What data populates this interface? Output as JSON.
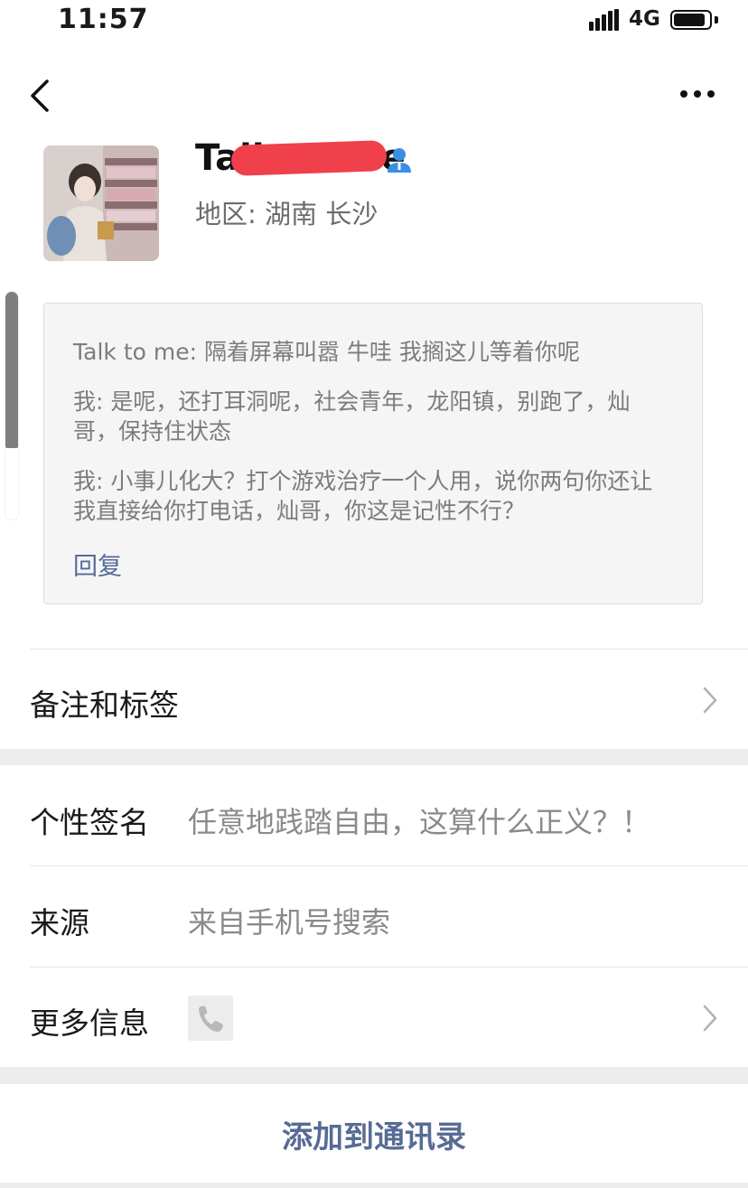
{
  "status_bar": {
    "time": "11:57",
    "network": "4G",
    "battery_level_pct": 90
  },
  "profile": {
    "name": "Talk to me",
    "region": "地区: 湖南 长沙"
  },
  "messages": [
    "Talk to me: 隔着屏幕叫嚣 牛哇   我搁这儿等着你呢",
    "我: 是呢，还打耳洞呢，社会青年，龙阳镇，别跑了，灿哥，保持住状态",
    "我: 小事儿化大？打个游戏治疗一个人用，说你两句你还让我直接给你打电话，灿哥，你这是记性不行？"
  ],
  "reply_label": "回复",
  "rows": {
    "remarks": {
      "label": "备注和标签"
    },
    "signature": {
      "label": "个性签名",
      "value": "任意地践踏自由，这算什么正义？！"
    },
    "source": {
      "label": "来源",
      "value": "来自手机号搜索"
    },
    "more_info": {
      "label": "更多信息",
      "icon": "phone-icon"
    }
  },
  "add_button_label": "添加到通讯录",
  "colors": {
    "link": "#576b95",
    "redaction": "#f0404b",
    "verified_icon": "#3a8ee6",
    "background_gap": "#ededed"
  }
}
